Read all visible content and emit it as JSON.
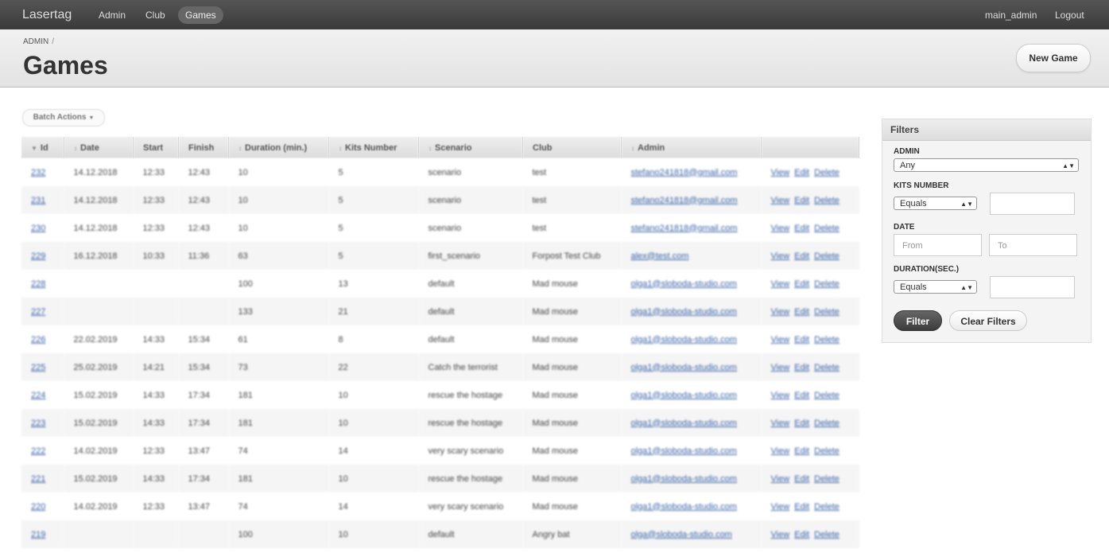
{
  "nav": {
    "brand": "Lasertag",
    "links": [
      "Admin",
      "Club",
      "Games"
    ],
    "active": "Games",
    "user": "main_admin",
    "logout": "Logout"
  },
  "header": {
    "breadcrumb": "ADMIN",
    "breadcrumb_sep": "/",
    "title": "Games",
    "new_button": "New Game"
  },
  "batch_actions": "Batch Actions",
  "table": {
    "columns": [
      "Id",
      "Date",
      "Start",
      "Finish",
      "Duration (min.)",
      "Kits Number",
      "Scenario",
      "Club",
      "Admin",
      ""
    ],
    "action_labels": [
      "View",
      "Edit",
      "Delete"
    ],
    "rows": [
      {
        "id": "232",
        "date": "14.12.2018",
        "start": "12:33",
        "finish": "12:43",
        "duration": "10",
        "kits": "5",
        "scenario": "scenario",
        "club": "test",
        "admin": "stefano241818@gmail.com"
      },
      {
        "id": "231",
        "date": "14.12.2018",
        "start": "12:33",
        "finish": "12:43",
        "duration": "10",
        "kits": "5",
        "scenario": "scenario",
        "club": "test",
        "admin": "stefano241818@gmail.com"
      },
      {
        "id": "230",
        "date": "14.12.2018",
        "start": "12:33",
        "finish": "12:43",
        "duration": "10",
        "kits": "5",
        "scenario": "scenario",
        "club": "test",
        "admin": "stefano241818@gmail.com"
      },
      {
        "id": "229",
        "date": "16.12.2018",
        "start": "10:33",
        "finish": "11:36",
        "duration": "63",
        "kits": "5",
        "scenario": "first_scenario",
        "club": "Forpost Test Club",
        "admin": "alex@test.com"
      },
      {
        "id": "228",
        "date": "",
        "start": "",
        "finish": "",
        "duration": "100",
        "kits": "13",
        "scenario": "default",
        "club": "Mad mouse",
        "admin": "olga1@sloboda-studio.com"
      },
      {
        "id": "227",
        "date": "",
        "start": "",
        "finish": "",
        "duration": "133",
        "kits": "21",
        "scenario": "default",
        "club": "Mad mouse",
        "admin": "olga1@sloboda-studio.com"
      },
      {
        "id": "226",
        "date": "22.02.2019",
        "start": "14:33",
        "finish": "15:34",
        "duration": "61",
        "kits": "8",
        "scenario": "default",
        "club": "Mad mouse",
        "admin": "olga1@sloboda-studio.com"
      },
      {
        "id": "225",
        "date": "25.02.2019",
        "start": "14:21",
        "finish": "15:34",
        "duration": "73",
        "kits": "22",
        "scenario": "Catch the terrorist",
        "club": "Mad mouse",
        "admin": "olga1@sloboda-studio.com"
      },
      {
        "id": "224",
        "date": "15.02.2019",
        "start": "14:33",
        "finish": "17:34",
        "duration": "181",
        "kits": "10",
        "scenario": "rescue the hostage",
        "club": "Mad mouse",
        "admin": "olga1@sloboda-studio.com"
      },
      {
        "id": "223",
        "date": "15.02.2019",
        "start": "14:33",
        "finish": "17:34",
        "duration": "181",
        "kits": "10",
        "scenario": "rescue the hostage",
        "club": "Mad mouse",
        "admin": "olga1@sloboda-studio.com"
      },
      {
        "id": "222",
        "date": "14.02.2019",
        "start": "12:33",
        "finish": "13:47",
        "duration": "74",
        "kits": "14",
        "scenario": "very scary scenario",
        "club": "Mad mouse",
        "admin": "olga1@sloboda-studio.com"
      },
      {
        "id": "221",
        "date": "15.02.2019",
        "start": "14:33",
        "finish": "17:34",
        "duration": "181",
        "kits": "10",
        "scenario": "rescue the hostage",
        "club": "Mad mouse",
        "admin": "olga1@sloboda-studio.com"
      },
      {
        "id": "220",
        "date": "14.02.2019",
        "start": "12:33",
        "finish": "13:47",
        "duration": "74",
        "kits": "14",
        "scenario": "very scary scenario",
        "club": "Mad mouse",
        "admin": "olga1@sloboda-studio.com"
      },
      {
        "id": "219",
        "date": "",
        "start": "",
        "finish": "",
        "duration": "100",
        "kits": "10",
        "scenario": "default",
        "club": "Angry bat",
        "admin": "olga@sloboda-studio.com"
      }
    ]
  },
  "filters": {
    "title": "Filters",
    "admin_label": "ADMIN",
    "admin_value": "Any",
    "kits_label": "KITS NUMBER",
    "kits_op": "Equals",
    "kits_value": "",
    "date_label": "DATE",
    "date_from_placeholder": "From",
    "date_to_placeholder": "To",
    "duration_label": "DURATION(SEC.)",
    "duration_op": "Equals",
    "duration_value": "",
    "filter_button": "Filter",
    "clear_button": "Clear Filters"
  }
}
